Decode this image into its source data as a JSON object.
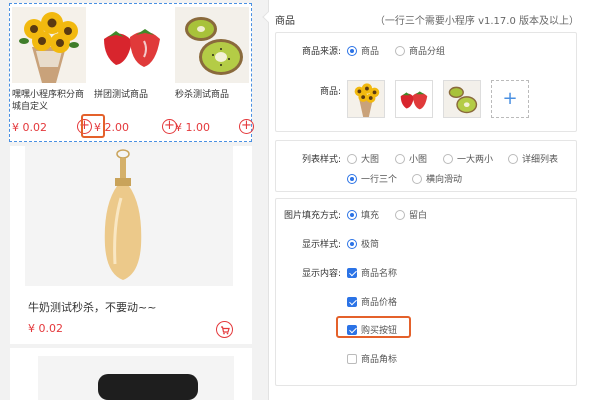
{
  "preview": {
    "goods": [
      {
        "name": "嘿嘿小程序积分商城自定义",
        "price": "¥ 0.02",
        "image": "sunflower-bouquet",
        "add": "+"
      },
      {
        "name": "拼团测试商品",
        "price": "¥ 2.00",
        "image": "strawberries",
        "add": "+"
      },
      {
        "name": "秒杀测试商品",
        "price": "¥ 1.00",
        "image": "kiwi",
        "add": "+"
      }
    ],
    "featured": {
      "name": "牛奶测试秒杀，不要动~~",
      "price": "¥ 0.02",
      "image": "perfume-bottle"
    }
  },
  "panel": {
    "title": "商品",
    "hint": "（一行三个需要小程序 v1.17.0 版本及以上）",
    "source": {
      "label": "商品来源:",
      "options": [
        "商品",
        "商品分组"
      ],
      "selected": 0
    },
    "goods_label": "商品:",
    "goods_add": "+",
    "list_style": {
      "label": "列表样式:",
      "options": [
        "大图",
        "小图",
        "一大两小",
        "详细列表",
        "一行三个",
        "横向滑动"
      ],
      "selected": 4
    },
    "fill": {
      "label": "图片填充方式:",
      "options": [
        "填充",
        "留白"
      ],
      "selected": 0
    },
    "display_style": {
      "label": "显示样式:",
      "options": [
        "极简"
      ],
      "selected": 0
    },
    "content": {
      "label": "显示内容:",
      "options": [
        "商品名称",
        "商品价格",
        "购买按钮",
        "商品角标"
      ],
      "checked": [
        true,
        true,
        true,
        false
      ]
    }
  },
  "colors": {
    "accent": "#2b73e6",
    "price": "#e4393c",
    "highlight": "#e4612b"
  }
}
